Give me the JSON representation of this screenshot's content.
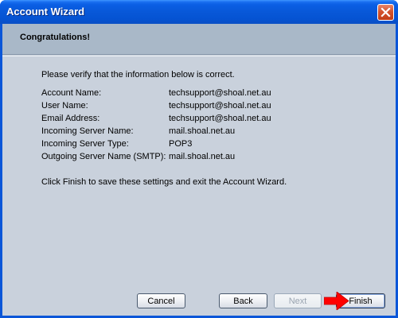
{
  "window": {
    "title": "Account Wizard"
  },
  "header": {
    "title": "Congratulations!"
  },
  "content": {
    "intro": "Please verify that the information below is correct.",
    "fields": [
      {
        "label": "Account Name:",
        "value": "techsupport@shoal.net.au"
      },
      {
        "label": "User Name:",
        "value": "techsupport@shoal.net.au"
      },
      {
        "label": "Email Address:",
        "value": "techsupport@shoal.net.au"
      },
      {
        "label": "Incoming Server Name:",
        "value": "mail.shoal.net.au"
      },
      {
        "label": "Incoming Server Type:",
        "value": "POP3"
      },
      {
        "label": "Outgoing Server Name (SMTP):",
        "value": "mail.shoal.net.au"
      }
    ],
    "outro": "Click Finish to save these settings and exit the Account Wizard."
  },
  "buttons": {
    "cancel": "Cancel",
    "back": "Back",
    "next": "Next",
    "finish": "Finish",
    "next_enabled": false
  },
  "colors": {
    "titlebar": "#0858d8",
    "header_band": "#a9b8c8",
    "client_bg": "#c9d1dc",
    "close_button": "#d4542e",
    "arrow": "#ff0000"
  },
  "icons": {
    "close": "close-icon",
    "annotation": "red-arrow-icon"
  }
}
